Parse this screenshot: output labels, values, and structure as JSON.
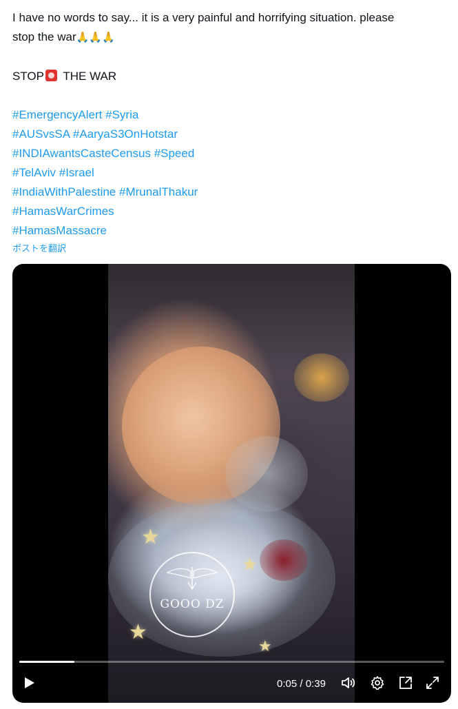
{
  "post": {
    "text_line1": "I have no words to say... it is a very painful and horrifying situation. please",
    "text_line2_prefix": "stop the war",
    "text_line2_emoji": "🙏🙏🙏",
    "stop_before": "STOP",
    "stop_after": " THE WAR",
    "hashtags": [
      "#EmergencyAlert",
      "#Syria",
      "#AUSvsSA",
      "#AaryaS3OnHotstar",
      "#INDIAwantsCasteCensus",
      "#Speed",
      "#TelAviv",
      "#Israel",
      "#IndiaWithPalestine",
      "#MrunalThakur",
      "#HamasWarCrimes",
      "#HamasMassacre"
    ],
    "translate_label": "ポストを翻訳"
  },
  "video": {
    "watermark_text": "GOOO DZ",
    "current_time": "0:05",
    "separator": " / ",
    "duration": "0:39",
    "progress_fraction": 0.13,
    "icons": [
      "play-icon",
      "volume-icon",
      "settings-icon",
      "pip-icon",
      "fullscreen-icon"
    ]
  },
  "colors": {
    "hashtag": "#1d9bf0",
    "text": "#0f1419",
    "video_bg": "#000000"
  }
}
